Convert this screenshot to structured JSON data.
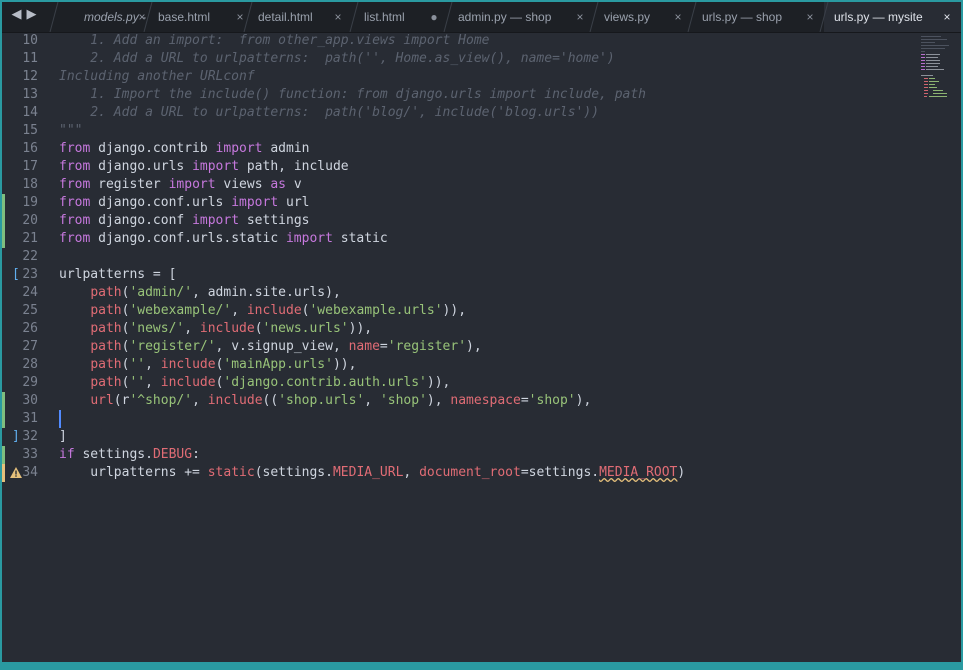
{
  "tabs": [
    {
      "label": "models.py -",
      "italic": true,
      "close": "×",
      "left": 0
    },
    {
      "label": "base.html",
      "close": "×"
    },
    {
      "label": "detail.html",
      "close": "×"
    },
    {
      "label": "list.html",
      "close": "●"
    },
    {
      "label": "admin.py — shop",
      "close": "×"
    },
    {
      "label": "views.py",
      "close": "×"
    },
    {
      "label": "urls.py — shop",
      "close": "×"
    },
    {
      "label": "urls.py — mysite",
      "close": "×",
      "active": true
    }
  ],
  "nav": {
    "back": "◀",
    "forward": "▶"
  },
  "lines": [
    {
      "n": "10",
      "code": [
        [
          "cm",
          "    1. Add an import:  from other_app.views import Home"
        ]
      ]
    },
    {
      "n": "11",
      "code": [
        [
          "cm",
          "    2. Add a URL to urlpatterns:  path('', Home.as_view(), name='home')"
        ]
      ]
    },
    {
      "n": "12",
      "code": [
        [
          "cm",
          "Including another URLconf"
        ]
      ]
    },
    {
      "n": "13",
      "code": [
        [
          "cm",
          "    1. Import the include() function: from django.urls import include, path"
        ]
      ]
    },
    {
      "n": "14",
      "code": [
        [
          "cm",
          "    2. Add a URL to urlpatterns:  path('blog/', include('blog.urls'))"
        ]
      ]
    },
    {
      "n": "15",
      "code": [
        [
          "cm",
          "\"\"\""
        ]
      ]
    },
    {
      "n": "16",
      "code": [
        [
          "kw",
          "from"
        ],
        [
          "pl",
          " django.contrib "
        ],
        [
          "kw",
          "import"
        ],
        [
          "pl",
          " admin"
        ]
      ]
    },
    {
      "n": "17",
      "code": [
        [
          "kw",
          "from"
        ],
        [
          "pl",
          " django.urls "
        ],
        [
          "kw",
          "import"
        ],
        [
          "pl",
          " path, include"
        ]
      ]
    },
    {
      "n": "18",
      "code": [
        [
          "kw",
          "from"
        ],
        [
          "pl",
          " register "
        ],
        [
          "kw",
          "import"
        ],
        [
          "pl",
          " views "
        ],
        [
          "kw",
          "as"
        ],
        [
          "pl",
          " v"
        ]
      ]
    },
    {
      "n": "19",
      "code": [
        [
          "kw",
          "from"
        ],
        [
          "pl",
          " django.conf.urls "
        ],
        [
          "kw",
          "import"
        ],
        [
          "pl",
          " url"
        ]
      ],
      "mark": "added"
    },
    {
      "n": "20",
      "code": [
        [
          "kw",
          "from"
        ],
        [
          "pl",
          " django.conf "
        ],
        [
          "kw",
          "import"
        ],
        [
          "pl",
          " settings"
        ]
      ],
      "mark": "added"
    },
    {
      "n": "21",
      "code": [
        [
          "kw",
          "from"
        ],
        [
          "pl",
          " django.conf.urls.static "
        ],
        [
          "kw",
          "import"
        ],
        [
          "pl",
          " static"
        ]
      ],
      "mark": "added"
    },
    {
      "n": "22",
      "code": []
    },
    {
      "n": "23",
      "code": [
        [
          "pl",
          "urlpatterns = ["
        ]
      ],
      "bracket": "["
    },
    {
      "n": "24",
      "code": [
        [
          "pl",
          "    "
        ],
        [
          "fn",
          "path"
        ],
        [
          "pl",
          "("
        ],
        [
          "str",
          "'admin/'"
        ],
        [
          "pl",
          ", admin.site.urls),"
        ]
      ]
    },
    {
      "n": "25",
      "code": [
        [
          "pl",
          "    "
        ],
        [
          "fn",
          "path"
        ],
        [
          "pl",
          "("
        ],
        [
          "str",
          "'webexample/'"
        ],
        [
          "pl",
          ", "
        ],
        [
          "fn",
          "include"
        ],
        [
          "pl",
          "("
        ],
        [
          "str",
          "'webexample.urls'"
        ],
        [
          "pl",
          ")),"
        ]
      ]
    },
    {
      "n": "26",
      "code": [
        [
          "pl",
          "    "
        ],
        [
          "fn",
          "path"
        ],
        [
          "pl",
          "("
        ],
        [
          "str",
          "'news/'"
        ],
        [
          "pl",
          ", "
        ],
        [
          "fn",
          "include"
        ],
        [
          "pl",
          "("
        ],
        [
          "str",
          "'news.urls'"
        ],
        [
          "pl",
          ")),"
        ]
      ]
    },
    {
      "n": "27",
      "code": [
        [
          "pl",
          "    "
        ],
        [
          "fn",
          "path"
        ],
        [
          "pl",
          "("
        ],
        [
          "str",
          "'register/'"
        ],
        [
          "pl",
          ", v.signup_view, "
        ],
        [
          "fn",
          "name"
        ],
        [
          "pl",
          "="
        ],
        [
          "str",
          "'register'"
        ],
        [
          "pl",
          "),"
        ]
      ]
    },
    {
      "n": "28",
      "code": [
        [
          "pl",
          "    "
        ],
        [
          "fn",
          "path"
        ],
        [
          "pl",
          "("
        ],
        [
          "str",
          "''"
        ],
        [
          "pl",
          ", "
        ],
        [
          "fn",
          "include"
        ],
        [
          "pl",
          "("
        ],
        [
          "str",
          "'mainApp.urls'"
        ],
        [
          "pl",
          ")),"
        ]
      ]
    },
    {
      "n": "29",
      "code": [
        [
          "pl",
          "    "
        ],
        [
          "fn",
          "path"
        ],
        [
          "pl",
          "("
        ],
        [
          "str",
          "''"
        ],
        [
          "pl",
          ", "
        ],
        [
          "fn",
          "include"
        ],
        [
          "pl",
          "("
        ],
        [
          "str",
          "'django.contrib.auth.urls'"
        ],
        [
          "pl",
          ")),"
        ]
      ]
    },
    {
      "n": "30",
      "code": [
        [
          "pl",
          "    "
        ],
        [
          "fn",
          "url"
        ],
        [
          "pl",
          "(r"
        ],
        [
          "str",
          "'^shop/'"
        ],
        [
          "pl",
          ", "
        ],
        [
          "fn",
          "include"
        ],
        [
          "pl",
          "(("
        ],
        [
          "str",
          "'shop.urls'"
        ],
        [
          "pl",
          ", "
        ],
        [
          "str",
          "'shop'"
        ],
        [
          "pl",
          "), "
        ],
        [
          "fn",
          "namespace"
        ],
        [
          "pl",
          "="
        ],
        [
          "str",
          "'shop'"
        ],
        [
          "pl",
          "),"
        ]
      ],
      "mark": "added"
    },
    {
      "n": "31",
      "code": [],
      "mark": "added",
      "cursor": true
    },
    {
      "n": "32",
      "code": [
        [
          "pl",
          "]"
        ]
      ],
      "bracket": "]"
    },
    {
      "n": "33",
      "code": [
        [
          "kw",
          "if"
        ],
        [
          "pl",
          " settings."
        ],
        [
          "fn",
          "DEBUG"
        ],
        [
          "pl",
          ":"
        ]
      ],
      "mark": "added"
    },
    {
      "n": "34",
      "code": [
        [
          "pl",
          "    urlpatterns += "
        ],
        [
          "fn",
          "static"
        ],
        [
          "pl",
          "(settings."
        ],
        [
          "fn",
          "MEDIA_URL"
        ],
        [
          "pl",
          ", "
        ],
        [
          "fn",
          "document_root"
        ],
        [
          "pl",
          "=settings."
        ],
        [
          "fn squig",
          "MEDIA_ROOT"
        ],
        [
          "pl",
          ")"
        ]
      ],
      "mark": "warn"
    }
  ],
  "colors": {
    "background": "#282c34",
    "tabbar": "#1d2025",
    "frame": "#2a9aa1"
  },
  "icons": {
    "warning": "warning-icon",
    "minimap": "minimap"
  }
}
